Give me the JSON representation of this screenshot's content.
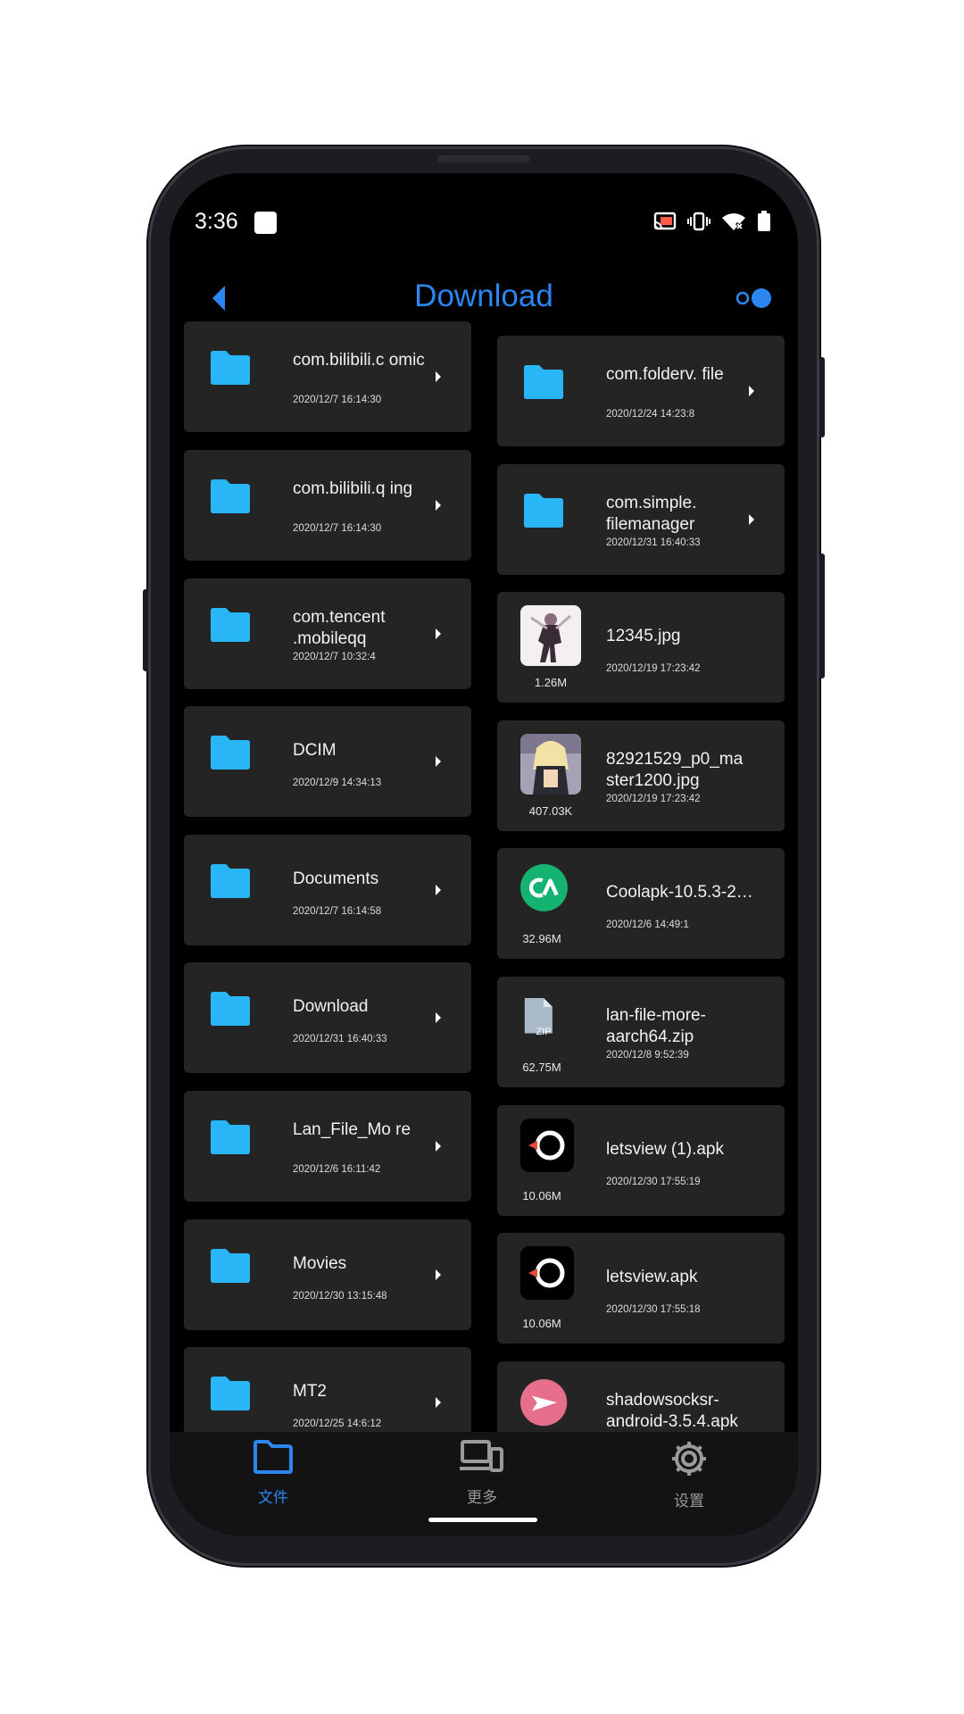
{
  "status_bar": {
    "time": "3:36"
  },
  "header": {
    "title": "Download"
  },
  "colors": {
    "accent": "#2b86f0",
    "folder": "#29b6f6",
    "card_bg": "#242424",
    "screen_bg": "#000000"
  },
  "left_column": [
    {
      "name": "com.bilibili.c omic",
      "date": "2020/12/7 16:14:30"
    },
    {
      "name": "com.bilibili.q ing",
      "date": "2020/12/7 16:14:30"
    },
    {
      "name": "com.tencent .mobileqq",
      "date": "2020/12/7 10:32:4"
    },
    {
      "name": "DCIM",
      "date": "2020/12/9 14:34:13"
    },
    {
      "name": "Documents",
      "date": "2020/12/7 16:14:58"
    },
    {
      "name": "Download",
      "date": "2020/12/31 16:40:33"
    },
    {
      "name": "Lan_File_Mo re",
      "date": "2020/12/6 16:11:42"
    },
    {
      "name": "Movies",
      "date": "2020/12/30 13:15:48"
    },
    {
      "name": "MT2",
      "date": "2020/12/25 14:6:12"
    }
  ],
  "right_column": [
    {
      "name": "com.folderv. file",
      "date": "2020/12/24 14:23:8"
    },
    {
      "name": "com.simple. filemanager",
      "date": "2020/12/31 16:40:33"
    },
    {
      "name": "12345.jpg",
      "date": "2020/12/19 17:23:42",
      "size": "1.26M"
    },
    {
      "name": "82921529_p0_ma ster1200.jpg",
      "date": "2020/12/19 17:23:42",
      "size": "407.03K"
    },
    {
      "name": "Coolapk-10.5.3-2…",
      "date": "2020/12/6 14:49:1",
      "size": "32.96M"
    },
    {
      "name": "lan-file-more- aarch64.zip",
      "date": "2020/12/8 9:52:39",
      "size": "62.75M",
      "badge": "ZIP"
    },
    {
      "name": "letsview (1).apk",
      "date": "2020/12/30 17:55:19",
      "size": "10.06M"
    },
    {
      "name": "letsview.apk",
      "date": "2020/12/30 17:55:18",
      "size": "10.06M"
    },
    {
      "name": "shadowsocksr- android-3.5.4.apk"
    }
  ],
  "bottom_nav": [
    {
      "label": "文件",
      "icon": "folder-icon",
      "active": true
    },
    {
      "label": "更多",
      "icon": "devices-icon",
      "active": false
    },
    {
      "label": "设置",
      "icon": "gear-icon",
      "active": false
    }
  ]
}
